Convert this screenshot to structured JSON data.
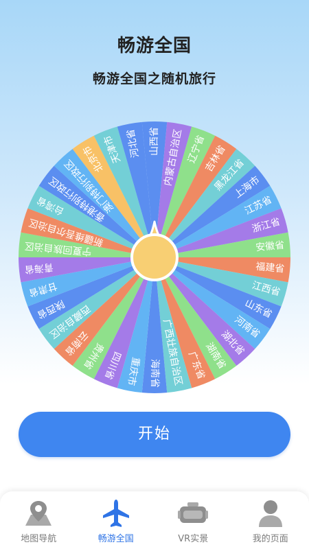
{
  "header": {
    "title": "畅游全国",
    "subtitle": "畅游全国之随机旅行"
  },
  "wheel": {
    "pointer_color": "#f8cf73",
    "segments": [
      {
        "label": "山西省",
        "color": "#5b8ef0"
      },
      {
        "label": "内蒙古自治区",
        "color": "#a47be8"
      },
      {
        "label": "辽宁省",
        "color": "#8fe08b"
      },
      {
        "label": "吉林省",
        "color": "#ef8a63"
      },
      {
        "label": "黑龙江省",
        "color": "#73cfd6"
      },
      {
        "label": "上海市",
        "color": "#5b8ef0"
      },
      {
        "label": "江苏省",
        "color": "#62b4f4"
      },
      {
        "label": "浙江省",
        "color": "#a47be8"
      },
      {
        "label": "安徽省",
        "color": "#8fe08b"
      },
      {
        "label": "福建省",
        "color": "#ef8a63"
      },
      {
        "label": "江西省",
        "color": "#73cfd6"
      },
      {
        "label": "山东省",
        "color": "#5b8ef0"
      },
      {
        "label": "河南省",
        "color": "#62b4f4"
      },
      {
        "label": "湖北省",
        "color": "#a47be8"
      },
      {
        "label": "湖南省",
        "color": "#8fe08b"
      },
      {
        "label": "广东省",
        "color": "#ef8a63"
      },
      {
        "label": "广西壮族自治区",
        "color": "#73cfd6"
      },
      {
        "label": "海南省",
        "color": "#5b8ef0"
      },
      {
        "label": "重庆市",
        "color": "#62b4f4"
      },
      {
        "label": "四川省",
        "color": "#a47be8"
      },
      {
        "label": "贵州省",
        "color": "#8fe08b"
      },
      {
        "label": "云南省",
        "color": "#ef8a63"
      },
      {
        "label": "西藏自治区",
        "color": "#73cfd6"
      },
      {
        "label": "陕西省",
        "color": "#5b8ef0"
      },
      {
        "label": "甘肃省",
        "color": "#62b4f4"
      },
      {
        "label": "青海省",
        "color": "#a47be8"
      },
      {
        "label": "宁夏回族自治区",
        "color": "#8fe08b"
      },
      {
        "label": "新疆维吾尔自治区",
        "color": "#ef8a63"
      },
      {
        "label": "台湾省",
        "color": "#73cfd6"
      },
      {
        "label": "香港特别行政区",
        "color": "#5b8ef0"
      },
      {
        "label": "澳门特别行政区",
        "color": "#62b4f4"
      },
      {
        "label": "北京市",
        "color": "#f8c166"
      },
      {
        "label": "天津市",
        "color": "#73cfd6"
      },
      {
        "label": "河北省",
        "color": "#5b8ef0"
      }
    ]
  },
  "start_button": {
    "label": "开始"
  },
  "tabbar": {
    "items": [
      {
        "label": "地图导航",
        "icon": "map-pin-icon",
        "active": false
      },
      {
        "label": "畅游全国",
        "icon": "airplane-icon",
        "active": true
      },
      {
        "label": "VR实景",
        "icon": "vr-headset-icon",
        "active": false
      },
      {
        "label": "我的页面",
        "icon": "user-icon",
        "active": false
      }
    ],
    "active_color": "#2f74e6",
    "inactive_color": "#9a9a9a"
  }
}
